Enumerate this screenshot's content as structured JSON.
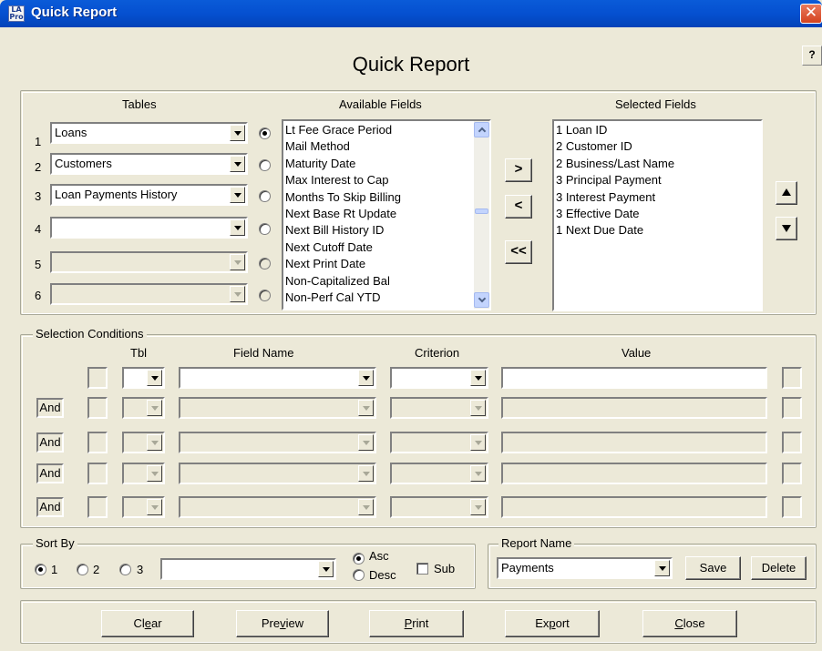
{
  "window": {
    "title": "Quick Report",
    "icon_text_line1": "LA",
    "icon_text_line2": "Pro",
    "close_symbol": "✕",
    "help_symbol": "?"
  },
  "heading": "Quick Report",
  "tables": {
    "label": "Tables",
    "rows": [
      {
        "num": "1",
        "value": "Loans",
        "enabled": true,
        "radio_selected": true
      },
      {
        "num": "2",
        "value": "Customers",
        "enabled": true,
        "radio_selected": false
      },
      {
        "num": "3",
        "value": "Loan Payments History",
        "enabled": true,
        "radio_selected": false
      },
      {
        "num": "4",
        "value": "",
        "enabled": true,
        "radio_selected": false
      },
      {
        "num": "5",
        "value": "",
        "enabled": false,
        "radio_selected": false
      },
      {
        "num": "6",
        "value": "",
        "enabled": false,
        "radio_selected": false
      }
    ]
  },
  "available_fields": {
    "label": "Available Fields",
    "items": [
      "Lt Fee Grace Period",
      "Mail Method",
      "Maturity Date",
      "Max Interest to Cap",
      "Months To Skip Billing",
      "Next Base Rt Update",
      "Next Bill History ID",
      "Next Cutoff Date",
      "Next Print Date",
      "Non-Capitalized Bal",
      "Non-Perf Cal YTD"
    ]
  },
  "transfer_buttons": {
    "add": ">",
    "remove": "<",
    "remove_all": "<<"
  },
  "selected_fields": {
    "label": "Selected Fields",
    "items": [
      "1  Loan ID",
      "2  Customer ID",
      "2  Business/Last Name",
      "3  Principal Payment",
      "3  Interest Payment",
      "3  Effective Date",
      "1  Next Due Date"
    ]
  },
  "selection_conditions": {
    "label": "Selection Conditions",
    "headers": {
      "tbl": "Tbl",
      "field_name": "Field Name",
      "criterion": "Criterion",
      "value": "Value"
    },
    "and_label": "And"
  },
  "sort_by": {
    "label": "Sort By",
    "options": [
      "1",
      "2",
      "3"
    ],
    "selected": "1",
    "field_value": "",
    "asc_label": "Asc",
    "desc_label": "Desc",
    "order_selected": "Asc",
    "sub_label": "Sub"
  },
  "report_name": {
    "label": "Report Name",
    "value": "Payments",
    "save_label": "Save",
    "delete_label": "Delete"
  },
  "bottom_buttons": {
    "clear": {
      "pre": "Cl",
      "ul": "e",
      "post": "ar"
    },
    "preview": {
      "pre": "Pre",
      "ul": "v",
      "post": "iew"
    },
    "print": {
      "pre": "",
      "ul": "P",
      "post": "rint"
    },
    "export": {
      "pre": "Ex",
      "ul": "p",
      "post": "ort"
    },
    "close": {
      "pre": "",
      "ul": "C",
      "post": "lose"
    }
  }
}
